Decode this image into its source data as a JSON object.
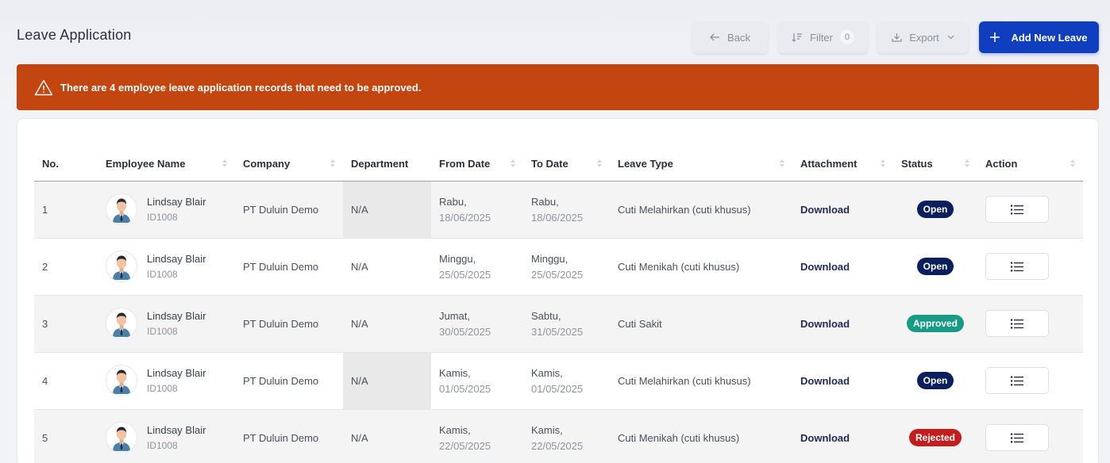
{
  "header": {
    "title": "Leave Application",
    "back_label": "Back",
    "filter_label": "Filter",
    "filter_count": "0",
    "export_label": "Export",
    "add_label": "Add New Leave"
  },
  "alert": {
    "message": "There are 4 employee leave application records that need to be approved."
  },
  "table": {
    "columns": [
      "No.",
      "Employee Name",
      "Company",
      "Department",
      "From Date",
      "To Date",
      "Leave Type",
      "Attachment",
      "Status",
      "Action"
    ],
    "rows": [
      {
        "no": "1",
        "name": "Lindsay Blair",
        "id": "ID1008",
        "company": "PT Duluin Demo",
        "department": "N/A",
        "from_day": "Rabu,",
        "from_date": "18/06/2025",
        "to_day": "Rabu,",
        "to_date": "18/06/2025",
        "leave_type": "Cuti Melahirkan (cuti khusus)",
        "attachment": "Download",
        "status": "Open"
      },
      {
        "no": "2",
        "name": "Lindsay Blair",
        "id": "ID1008",
        "company": "PT Duluin Demo",
        "department": "N/A",
        "from_day": "Minggu,",
        "from_date": "25/05/2025",
        "to_day": "Minggu,",
        "to_date": "25/05/2025",
        "leave_type": "Cuti Menikah (cuti khusus)",
        "attachment": "Download",
        "status": "Open"
      },
      {
        "no": "3",
        "name": "Lindsay Blair",
        "id": "ID1008",
        "company": "PT Duluin Demo",
        "department": "N/A",
        "from_day": "Jumat,",
        "from_date": "30/05/2025",
        "to_day": "Sabtu,",
        "to_date": "31/05/2025",
        "leave_type": "Cuti Sakit",
        "attachment": "Download",
        "status": "Approved"
      },
      {
        "no": "4",
        "name": "Lindsay Blair",
        "id": "ID1008",
        "company": "PT Duluin Demo",
        "department": "N/A",
        "from_day": "Kamis,",
        "from_date": "01/05/2025",
        "to_day": "Kamis,",
        "to_date": "01/05/2025",
        "leave_type": "Cuti Melahirkan (cuti khusus)",
        "attachment": "Download",
        "status": "Open"
      },
      {
        "no": "5",
        "name": "Lindsay Blair",
        "id": "ID1008",
        "company": "PT Duluin Demo",
        "department": "N/A",
        "from_day": "Kamis,",
        "from_date": "22/05/2025",
        "to_day": "Kamis,",
        "to_date": "22/05/2025",
        "leave_type": "Cuti Menikah (cuti khusus)",
        "attachment": "Download",
        "status": "Rejected"
      }
    ]
  },
  "colors": {
    "primary": "#0f3fbf",
    "alert": "#c3450f",
    "status_open": "#0b1f5e",
    "status_approved": "#179b85",
    "status_rejected": "#c41d1d"
  },
  "icons": {
    "back": "arrow-left-icon",
    "filter": "filter-icon",
    "export": "download-icon",
    "add": "plus-icon",
    "alert": "warning-triangle-icon",
    "avatar": "user-avatar-icon",
    "action": "list-icon"
  }
}
